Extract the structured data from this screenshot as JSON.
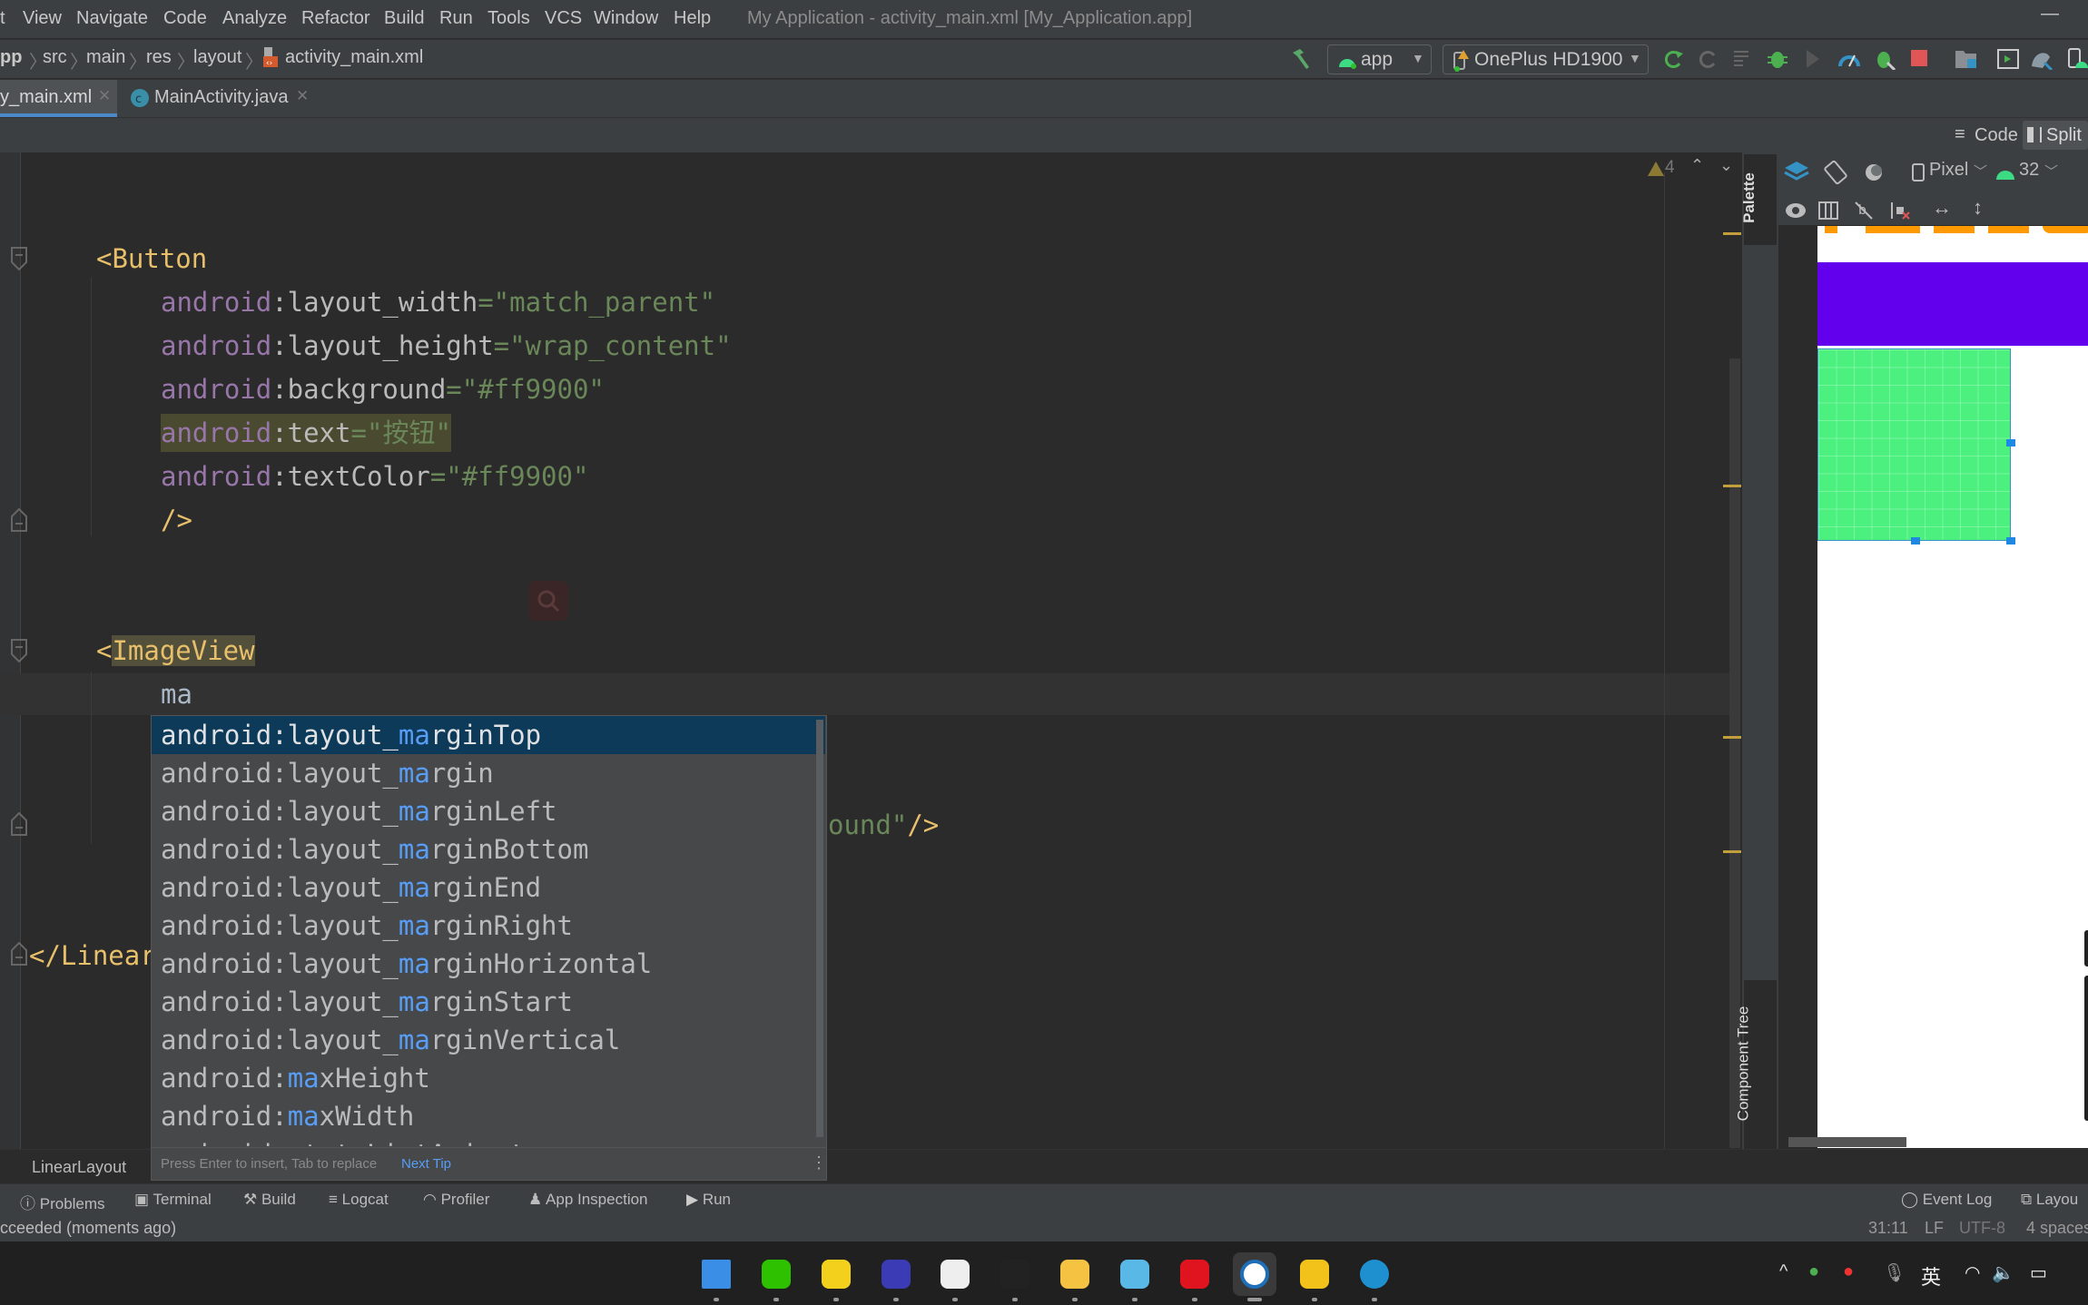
{
  "menu": {
    "items": [
      "t",
      "View",
      "Navigate",
      "Code",
      "Analyze",
      "Refactor",
      "Build",
      "Run",
      "Tools",
      "VCS",
      "Window",
      "Help"
    ],
    "title": "My Application - activity_main.xml [My_Application.app]",
    "minimize": "—"
  },
  "breadcrumb": [
    "pp",
    "src",
    "main",
    "res",
    "layout",
    "activity_main.xml"
  ],
  "toolbar": {
    "run_config": "app",
    "device": "OnePlus HD1900",
    "colors": {
      "run": "#4caf50",
      "stop": "#e05555"
    }
  },
  "tabs": [
    {
      "label": "y_main.xml",
      "active": true
    },
    {
      "label": "MainActivity.java",
      "active": false,
      "icon": "class-c-icon"
    }
  ],
  "view_modes": {
    "code": "Code",
    "split": "Split",
    "selected": "Split"
  },
  "editor": {
    "warnings": "4",
    "lines": [
      {
        "line": 0,
        "segments": [
          [
            "tag",
            "<Button"
          ]
        ]
      },
      {
        "line": 1,
        "segments": [
          [
            "ns",
            "android"
          ],
          [
            "at",
            ":layout_width"
          ],
          [
            "st",
            "=\"match_parent\""
          ]
        ]
      },
      {
        "line": 2,
        "segments": [
          [
            "ns",
            "android"
          ],
          [
            "at",
            ":layout_height"
          ],
          [
            "st",
            "=\"wrap_content\""
          ]
        ]
      },
      {
        "line": 3,
        "segments": [
          [
            "ns",
            "android"
          ],
          [
            "at",
            ":background"
          ],
          [
            "st",
            "=\"#ff9900\""
          ]
        ]
      },
      {
        "line": 4,
        "highlight": true,
        "segments": [
          [
            "ns",
            "android"
          ],
          [
            "at",
            ":text"
          ],
          [
            "st",
            "=\"按钮\""
          ]
        ]
      },
      {
        "line": 5,
        "segments": [
          [
            "ns",
            "android"
          ],
          [
            "at",
            ":textColor"
          ],
          [
            "st",
            "=\"#ff9900\""
          ]
        ]
      },
      {
        "line": 6,
        "segments": [
          [
            "tag",
            "/>"
          ]
        ]
      },
      {
        "line": 9,
        "segments": [
          [
            "tag",
            "<"
          ],
          [
            "tagh",
            "ImageView"
          ]
        ]
      },
      {
        "line": 10,
        "segments": [
          [
            "pl",
            "ma"
          ]
        ]
      },
      {
        "line": 13,
        "offset": "tail",
        "segments": [
          [
            "st",
            "ound\""
          ],
          [
            "tag",
            "/>"
          ]
        ]
      },
      {
        "line": 16,
        "outdent": true,
        "segments": [
          [
            "tag",
            "</Linear"
          ]
        ]
      }
    ]
  },
  "completion": {
    "typed": "ma",
    "items": [
      {
        "pre": "android:layout_",
        "m": "ma",
        "post": "rginTop",
        "selected": true
      },
      {
        "pre": "android:layout_",
        "m": "ma",
        "post": "rgin"
      },
      {
        "pre": "android:layout_",
        "m": "ma",
        "post": "rginLeft"
      },
      {
        "pre": "android:layout_",
        "m": "ma",
        "post": "rginBottom"
      },
      {
        "pre": "android:layout_",
        "m": "ma",
        "post": "rginEnd"
      },
      {
        "pre": "android:layout_",
        "m": "ma",
        "post": "rginRight"
      },
      {
        "pre": "android:layout_",
        "m": "ma",
        "post": "rginHorizontal"
      },
      {
        "pre": "android:layout_",
        "m": "ma",
        "post": "rginStart"
      },
      {
        "pre": "android:layout_",
        "m": "ma",
        "post": "rginVertical"
      },
      {
        "pre": "android:",
        "m": "ma",
        "post": "xHeight"
      },
      {
        "pre": "android:",
        "m": "ma",
        "post": "xWidth"
      },
      {
        "pre": "android:stateListAni",
        "m": "ma",
        "post": "tor"
      }
    ],
    "hint": "Press Enter to insert, Tab to replace",
    "next_tip": "Next Tip"
  },
  "design": {
    "palette": "Palette",
    "component_tree": "Component Tree",
    "device": "Pixel",
    "api": "32",
    "colors": {
      "purple": "#6200ee",
      "green": "#4cf07f",
      "orange": "#ff9900"
    }
  },
  "editor_breadcrumb": "LinearLayout",
  "tool_windows": {
    "left": [
      "Problems",
      "Terminal",
      "Build",
      "Logcat",
      "Profiler",
      "App Inspection",
      "Run"
    ],
    "right": [
      "Event Log",
      "Layou"
    ]
  },
  "status": {
    "message": "cceeded (moments ago)",
    "position": "31:11",
    "line_sep": "LF",
    "encoding": "UTF-8",
    "indent": "4 spaces"
  },
  "taskbar": {
    "apps": [
      "windows-start-icon",
      "wechat-icon",
      "music-icon",
      "intellij-icon",
      "typora-icon",
      "obs-icon",
      "file-explorer-icon",
      "notepad-icon",
      "youdao-icon",
      "android-studio-icon",
      "app-icon",
      "edge-icon"
    ],
    "tray_lang": "英"
  }
}
